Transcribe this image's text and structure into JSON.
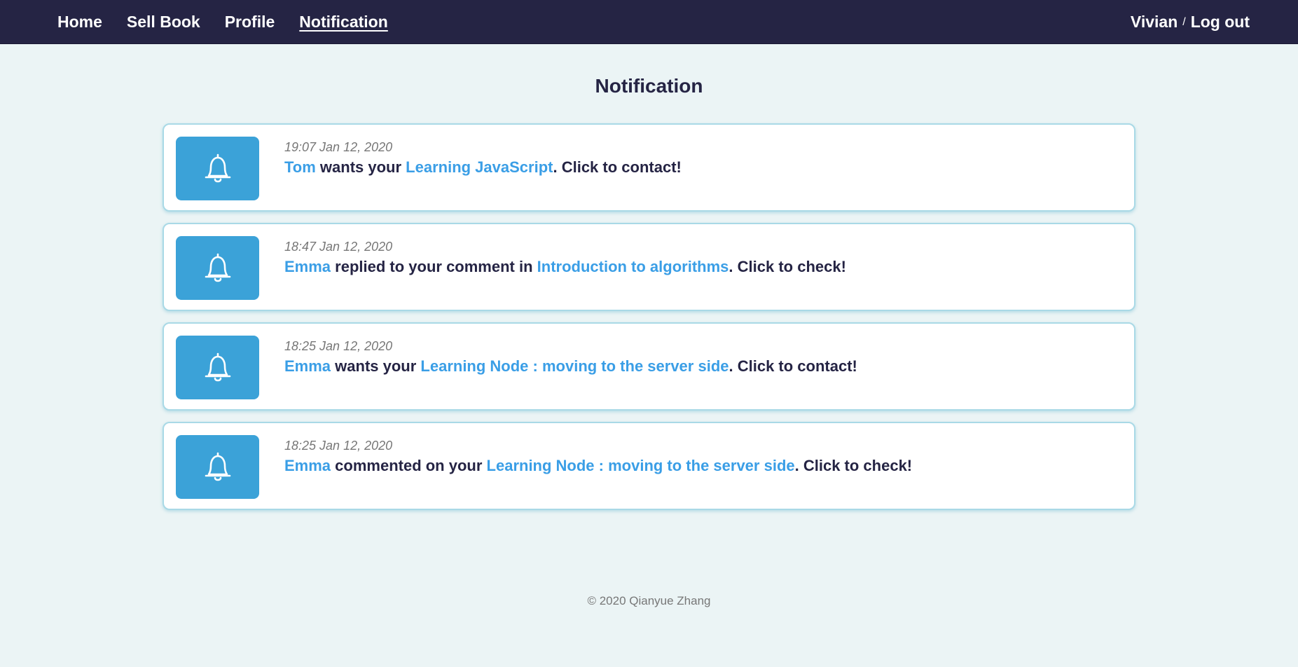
{
  "nav": {
    "links": [
      "Home",
      "Sell Book",
      "Profile",
      "Notification"
    ],
    "active": "Notification",
    "user": "Vivian",
    "separator": "/",
    "logout": "Log out"
  },
  "page": {
    "title": "Notification"
  },
  "notifications": [
    {
      "icon": "bell-icon",
      "time": "19:07 Jan 12, 2020",
      "actor": "Tom",
      "mid": " wants your ",
      "subject": "Learning JavaScript",
      "tail": ". Click to contact!"
    },
    {
      "icon": "bell-icon",
      "time": "18:47 Jan 12, 2020",
      "actor": "Emma",
      "mid": " replied to your comment in ",
      "subject": "Introduction to algorithms",
      "tail": ". Click to check!"
    },
    {
      "icon": "bell-icon",
      "time": "18:25 Jan 12, 2020",
      "actor": "Emma",
      "mid": " wants your ",
      "subject": "Learning Node : moving to the server side",
      "tail": ". Click to contact!"
    },
    {
      "icon": "bell-icon",
      "time": "18:25 Jan 12, 2020",
      "actor": "Emma",
      "mid": " commented on your ",
      "subject": "Learning Node : moving to the server side",
      "tail": ". Click to check!"
    }
  ],
  "footer": {
    "copyright": "© 2020 Qianyue Zhang"
  },
  "colors": {
    "navbar": "#252444",
    "background": "#ebf4f5",
    "accent": "#3ba2d8",
    "link": "#3a9ee6",
    "text": "#252444"
  }
}
